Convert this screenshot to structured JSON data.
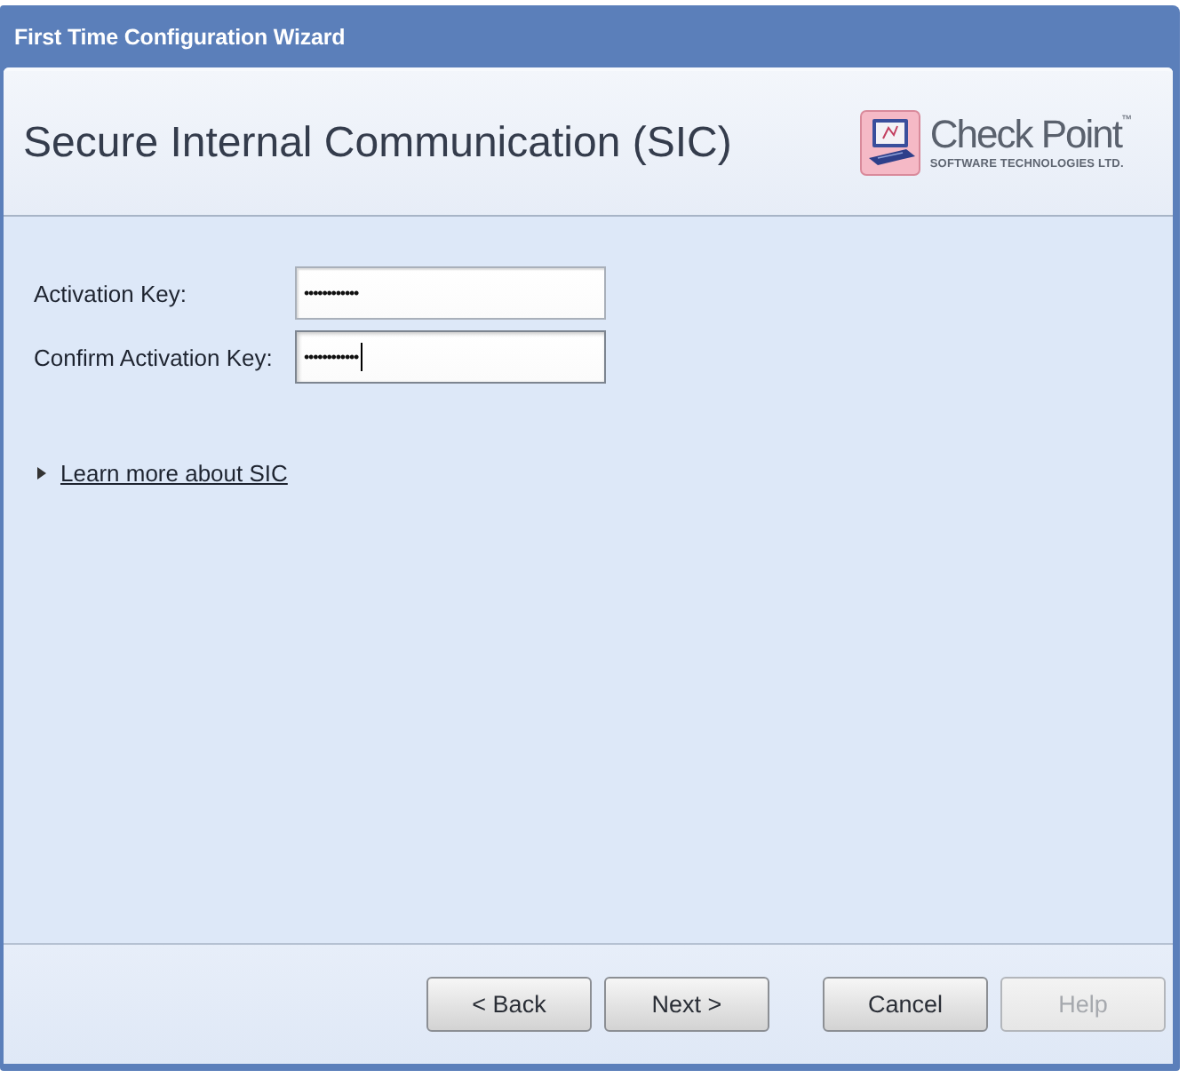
{
  "window": {
    "title": "First Time Configuration Wizard"
  },
  "header": {
    "title": "Secure Internal Communication (SIC)",
    "logo": {
      "name": "Check Point$^{™}$",
      "tagline": "SOFTWARE TECHNOLOGIES LTD."
    }
  },
  "fields": [
    {
      "label": "Activation Key:",
      "value": "••••••••••••",
      "focused": false
    },
    {
      "label": "Confirm Activation Key:",
      "value": "••••••••••••",
      "focused": true
    }
  ],
  "link": {
    "label": "Learn more about SIC",
    "expanded": false
  },
  "buttons": [
    {
      "label": "< Back",
      "disabled": false
    },
    {
      "label": "Next >",
      "disabled": false
    },
    {
      "label": "Cancel",
      "disabled": false
    },
    {
      "label": "Help",
      "disabled": true
    }
  ]
}
